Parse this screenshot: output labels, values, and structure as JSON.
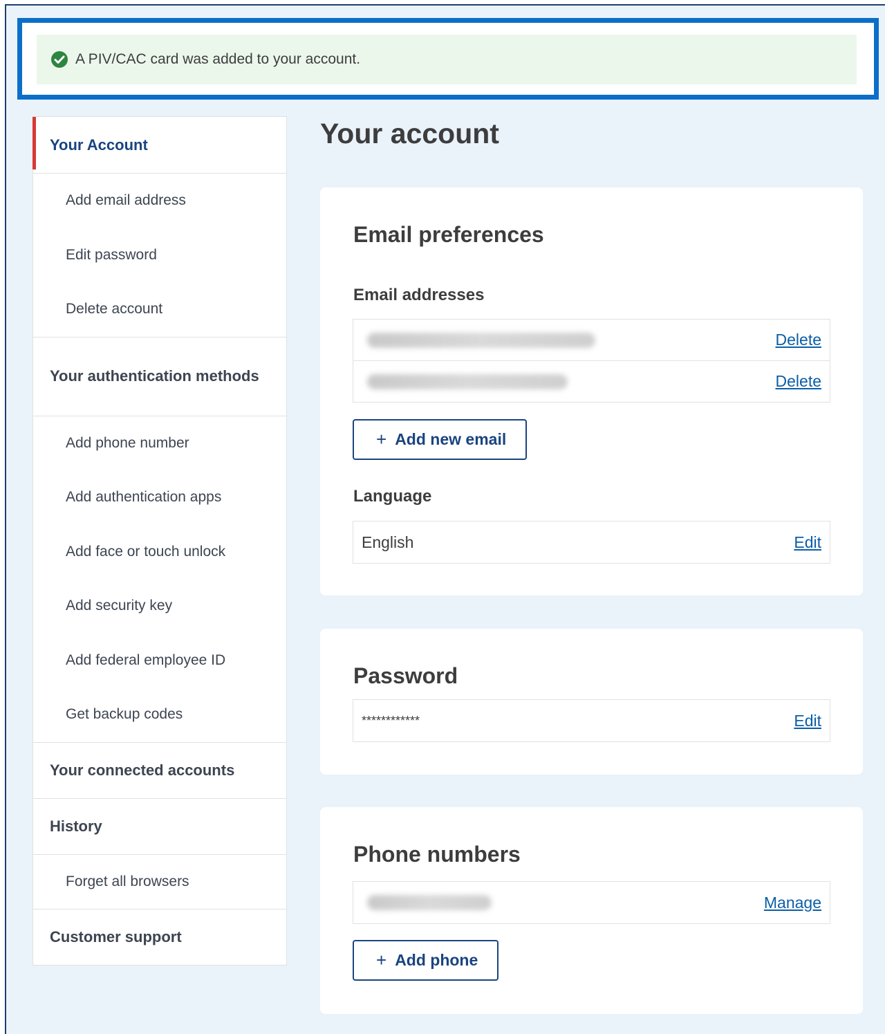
{
  "alert": {
    "message": "A PIV/CAC card was added to your account.",
    "icon": "check-circle-icon",
    "status_color": "#2e8540"
  },
  "sidenav": {
    "top": "Your Account",
    "account_items": [
      "Add email address",
      "Edit password",
      "Delete account"
    ],
    "auth_section": "Your authentication methods",
    "auth_items": [
      "Add phone number",
      "Add authentication apps",
      "Add face or touch unlock",
      "Add security key",
      "Add federal employee ID",
      "Get backup codes"
    ],
    "connected": "Your connected accounts",
    "history": "History",
    "history_items": [
      "Forget all browsers"
    ],
    "support": "Customer support"
  },
  "main": {
    "title": "Your account",
    "email_card": {
      "title": "Email preferences",
      "addresses_label": "Email addresses",
      "delete_label": "Delete",
      "add_email": "Add new email",
      "language_label": "Language",
      "language_value": "English",
      "edit_label": "Edit"
    },
    "password_card": {
      "title": "Password",
      "value": "************",
      "edit_label": "Edit"
    },
    "phone_card": {
      "title": "Phone numbers",
      "manage_label": "Manage",
      "add_phone": "Add phone"
    }
  },
  "colors": {
    "accent": "#1a4480",
    "link": "#0b5ea8",
    "current_marker": "#d83933",
    "alert_outline": "#0b6fc9",
    "alert_bg": "#ecf7ec"
  }
}
